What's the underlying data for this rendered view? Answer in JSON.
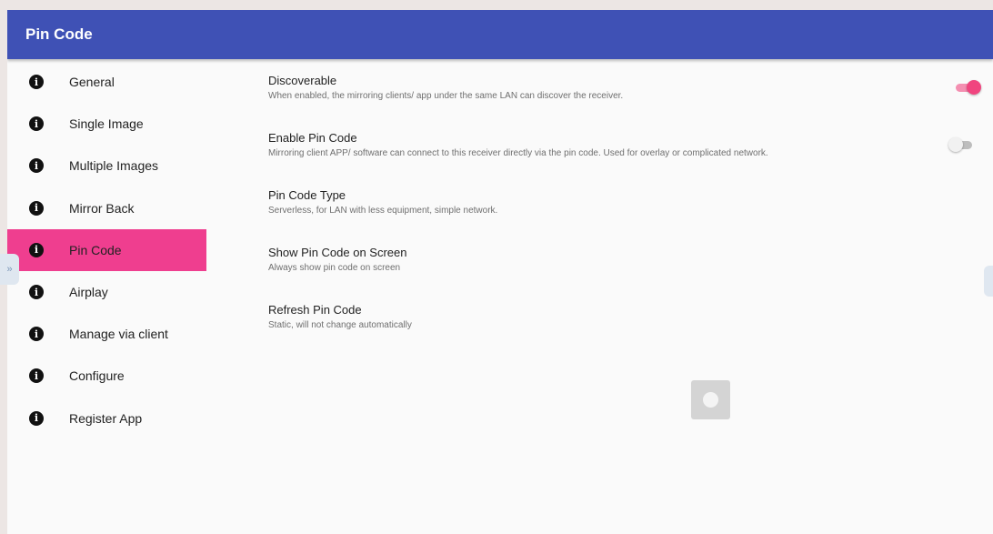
{
  "appbar": {
    "title": "Pin Code"
  },
  "sidebar": {
    "items": [
      {
        "label": "General",
        "selected": false
      },
      {
        "label": "Single Image",
        "selected": false
      },
      {
        "label": "Multiple Images",
        "selected": false
      },
      {
        "label": "Mirror Back",
        "selected": false
      },
      {
        "label": "Pin Code",
        "selected": true
      },
      {
        "label": "Airplay",
        "selected": false
      },
      {
        "label": "Manage via client",
        "selected": false
      },
      {
        "label": "Configure",
        "selected": false
      },
      {
        "label": "Register App",
        "selected": false
      }
    ]
  },
  "settings": [
    {
      "title": "Discoverable",
      "desc": "When enabled, the mirroring clients/ app under the same LAN can discover the receiver.",
      "toggle": "on"
    },
    {
      "title": "Enable Pin Code",
      "desc": "Mirroring client APP/ software can connect to this receiver directly via the pin code. Used for overlay or complicated network.",
      "toggle": "off"
    },
    {
      "title": "Pin Code Type",
      "desc": "Serverless, for LAN with less equipment, simple network."
    },
    {
      "title": "Show Pin Code on Screen",
      "desc": "Always show pin code on screen"
    },
    {
      "title": "Refresh Pin Code",
      "desc": "Static, will not change automatically"
    }
  ],
  "handles": {
    "left_glyph": "»"
  },
  "colors": {
    "appbar": "#3f51b5",
    "selected_item": "#ef3e8f",
    "toggle_on_thumb": "#f0457f",
    "toggle_on_track": "#f48fb1"
  }
}
